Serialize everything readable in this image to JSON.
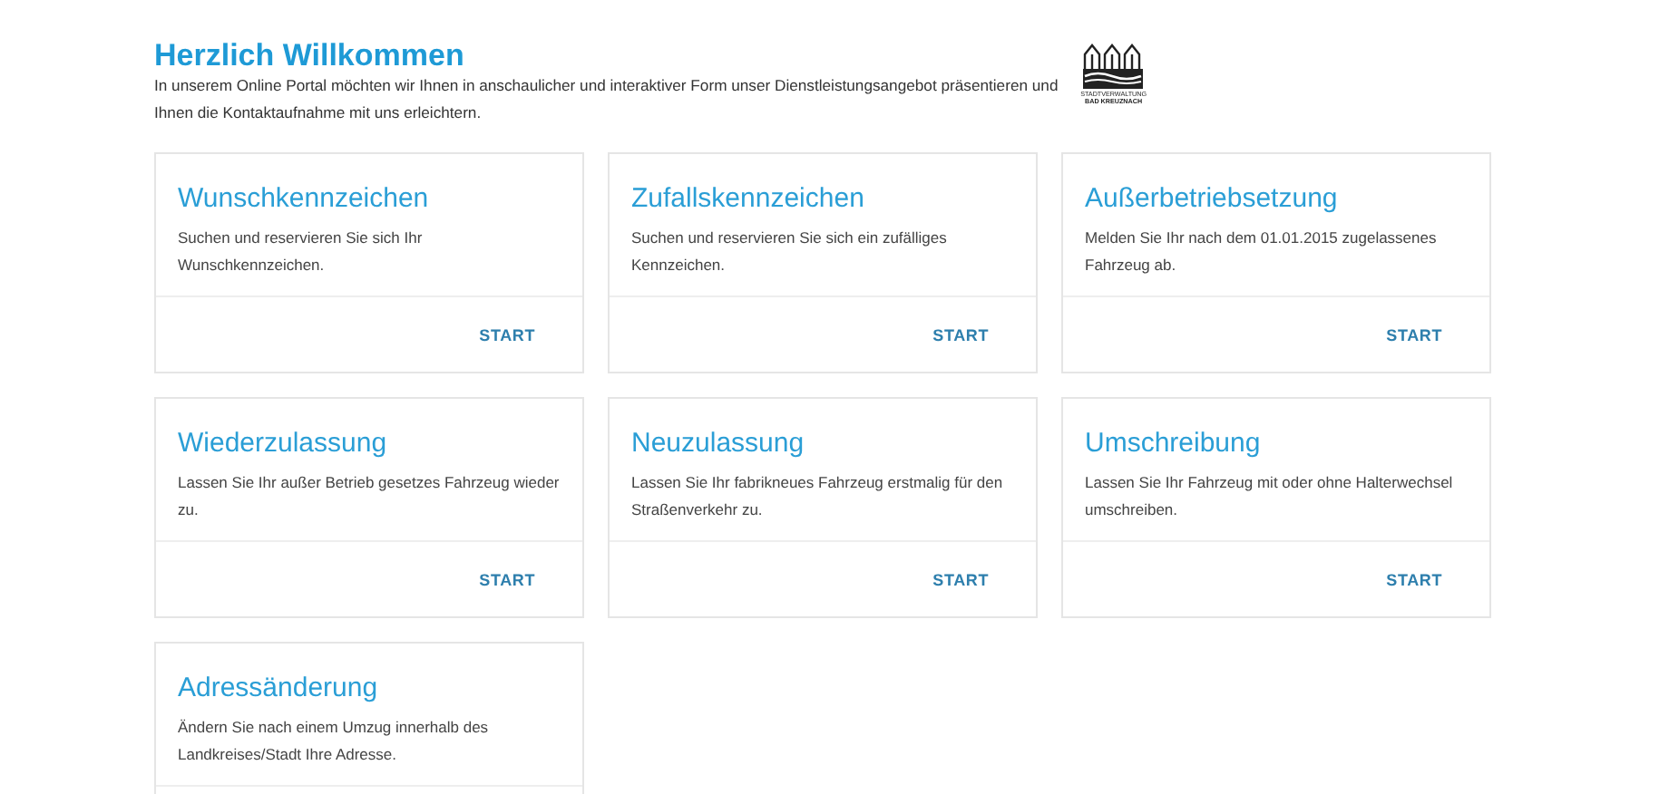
{
  "heading": "Herzlich Willkommen",
  "intro": "In unserem Online Portal möchten wir Ihnen in anschaulicher und interaktiver Form unser Dienstleistungsangebot präsentieren und Ihnen die Kontaktaufnahme mit uns erleichtern.",
  "logo": {
    "lines": [
      "STADTVERWALTUNG",
      "BAD KREUZNACH"
    ]
  },
  "cards": [
    {
      "title": "Wunschkennzeichen",
      "text": "Suchen und reservieren Sie sich Ihr Wunschkennzeichen.",
      "button": "START"
    },
    {
      "title": "Zufallskennzeichen",
      "text": "Suchen und reservieren Sie sich ein zufälliges Kennzeichen.",
      "button": "START"
    },
    {
      "title": "Außerbetriebsetzung",
      "text": "Melden Sie Ihr nach dem 01.01.2015 zugelassenes Fahrzeug ab.",
      "button": "START"
    },
    {
      "title": "Wiederzulassung",
      "text": "Lassen Sie Ihr außer Betrieb gesetzes Fahrzeug wieder zu.",
      "button": "START"
    },
    {
      "title": "Neuzulassung",
      "text": "Lassen Sie Ihr fabrikneues Fahrzeug erstmalig für den Straßenverkehr zu.",
      "button": "START"
    },
    {
      "title": "Umschreibung",
      "text": "Lassen Sie Ihr Fahrzeug mit oder ohne Halterwechsel umschreiben.",
      "button": "START"
    },
    {
      "title": "Adressänderung",
      "text": "Ändern Sie nach einem Umzug innerhalb des Landkreises/Stadt Ihre Adresse."
    }
  ]
}
